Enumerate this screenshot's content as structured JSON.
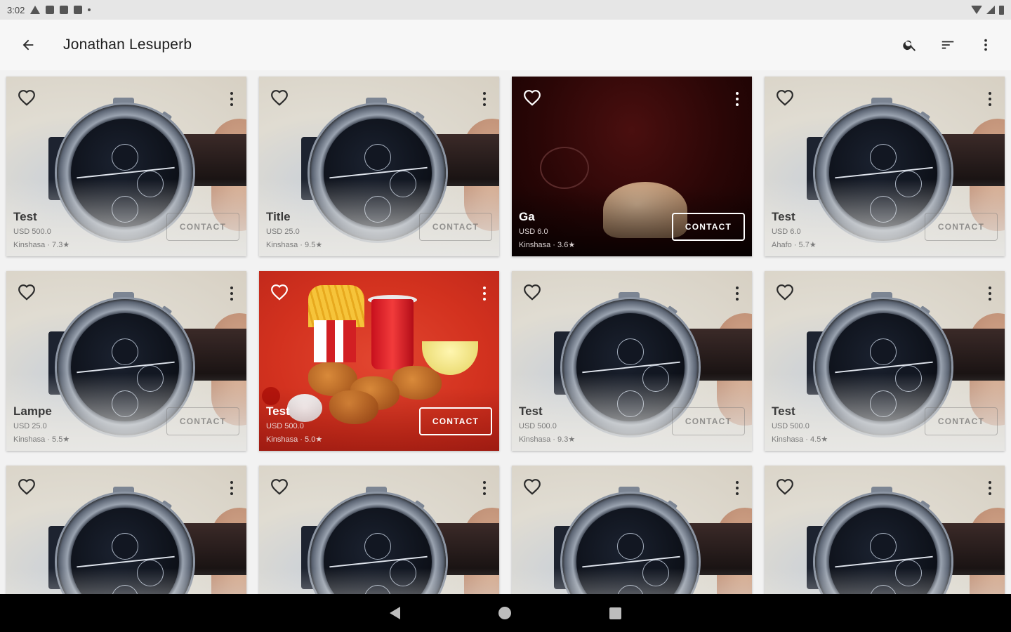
{
  "status_bar": {
    "time": "3:02"
  },
  "app_bar": {
    "title": "Jonathan Lesuperb"
  },
  "contact_label": "CONTACT",
  "products": [
    {
      "name": "Test",
      "price": "USD 500.0",
      "meta": "Kinshasa · 7.3★",
      "image": "watch"
    },
    {
      "name": "Title",
      "price": "USD 25.0",
      "meta": "Kinshasa · 9.5★",
      "image": "watch"
    },
    {
      "name": "Ga",
      "price": "USD 6.0",
      "meta": "Kinshasa · 3.6★",
      "image": "dark-room"
    },
    {
      "name": "Test",
      "price": "USD 6.0",
      "meta": "Ahafo · 5.7★",
      "image": "watch"
    },
    {
      "name": "Lampe",
      "price": "USD 25.0",
      "meta": "Kinshasa · 5.5★",
      "image": "watch"
    },
    {
      "name": "Test",
      "price": "USD 500.0",
      "meta": "Kinshasa · 5.0★",
      "image": "fast-food"
    },
    {
      "name": "Test",
      "price": "USD 500.0",
      "meta": "Kinshasa · 9.3★",
      "image": "watch"
    },
    {
      "name": "Test",
      "price": "USD 500.0",
      "meta": "Kinshasa · 4.5★",
      "image": "watch"
    },
    {
      "name": "",
      "price": "",
      "meta": "",
      "image": "watch"
    },
    {
      "name": "",
      "price": "",
      "meta": "",
      "image": "watch"
    },
    {
      "name": "",
      "price": "",
      "meta": "",
      "image": "watch"
    },
    {
      "name": "",
      "price": "",
      "meta": "",
      "image": "watch"
    }
  ],
  "icons": {
    "back": "arrow-back-icon",
    "search": "search-icon",
    "sort": "sort-icon",
    "more": "more-vert-icon",
    "favorite": "heart-outline-icon"
  }
}
